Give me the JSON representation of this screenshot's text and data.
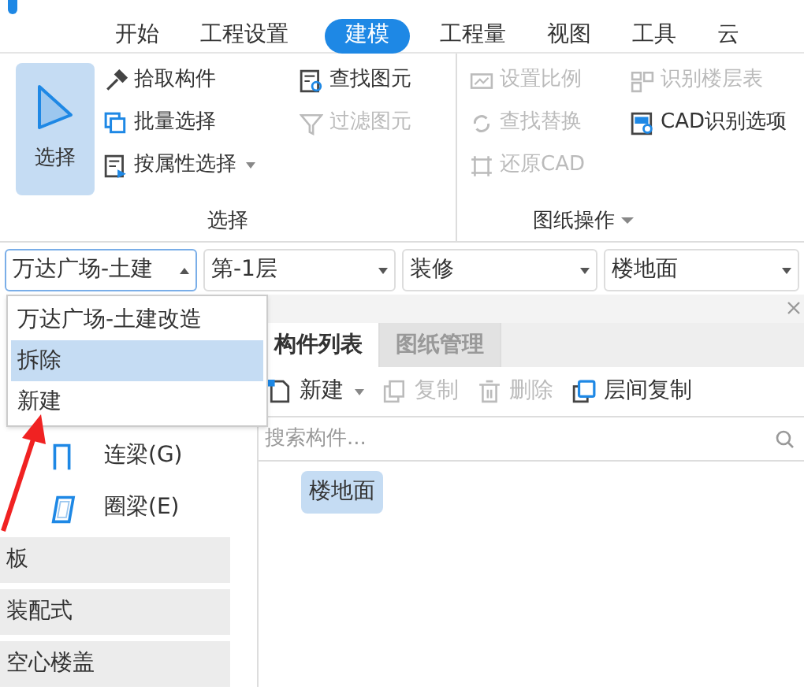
{
  "menu_tabs": [
    {
      "label": "开始",
      "selected": false
    },
    {
      "label": "工程设置",
      "selected": false
    },
    {
      "label": "建模",
      "selected": true
    },
    {
      "label": "工程量",
      "selected": false
    },
    {
      "label": "视图",
      "selected": false
    },
    {
      "label": "工具",
      "selected": false
    },
    {
      "label": "云",
      "selected": false
    }
  ],
  "ribbon": {
    "select_button": {
      "label": "选择",
      "selected": true
    },
    "select_group": {
      "title": "选择",
      "items": [
        {
          "label": "拾取构件",
          "disabled": false
        },
        {
          "label": "批量选择",
          "disabled": false
        },
        {
          "label": "按属性选择",
          "disabled": false,
          "has_menu": true
        },
        {
          "label": "查找图元",
          "disabled": false
        },
        {
          "label": "过滤图元",
          "disabled": true
        }
      ]
    },
    "drawing_group": {
      "title": "图纸操作",
      "items": [
        {
          "label": "设置比例",
          "disabled": true
        },
        {
          "label": "查找替换",
          "disabled": true
        },
        {
          "label": "还原CAD",
          "disabled": true
        },
        {
          "label": "识别楼层表",
          "disabled": true
        },
        {
          "label": "CAD识别选项",
          "disabled": false
        }
      ]
    }
  },
  "combos": [
    {
      "value": "万达广场-土建",
      "open": true
    },
    {
      "value": "第-1层",
      "open": false
    },
    {
      "value": "装修",
      "open": false
    },
    {
      "value": "楼地面",
      "open": false
    }
  ],
  "dropdown": {
    "options": [
      {
        "label": "万达广场-土建改造",
        "selected": false
      },
      {
        "label": "拆除",
        "selected": true
      },
      {
        "label": "新建",
        "selected": false
      }
    ]
  },
  "left_panel": {
    "items": [
      {
        "label": "连梁(G)",
        "kind": "item"
      },
      {
        "label": "圈梁(E)",
        "kind": "item"
      },
      {
        "label": "板",
        "kind": "group"
      },
      {
        "label": "装配式",
        "kind": "group"
      },
      {
        "label": "空心楼盖",
        "kind": "group"
      }
    ]
  },
  "right_panel": {
    "tabs": [
      {
        "label": "构件列表",
        "selected": true
      },
      {
        "label": "图纸管理",
        "selected": false
      }
    ],
    "toolbar": [
      {
        "label": "新建",
        "disabled": false,
        "has_menu": true
      },
      {
        "label": "复制",
        "disabled": true
      },
      {
        "label": "删除",
        "disabled": true
      },
      {
        "label": "层间复制",
        "disabled": false
      }
    ],
    "search": {
      "placeholder": "搜索构件..."
    },
    "list": [
      {
        "label": "楼地面",
        "selected": true
      }
    ]
  }
}
